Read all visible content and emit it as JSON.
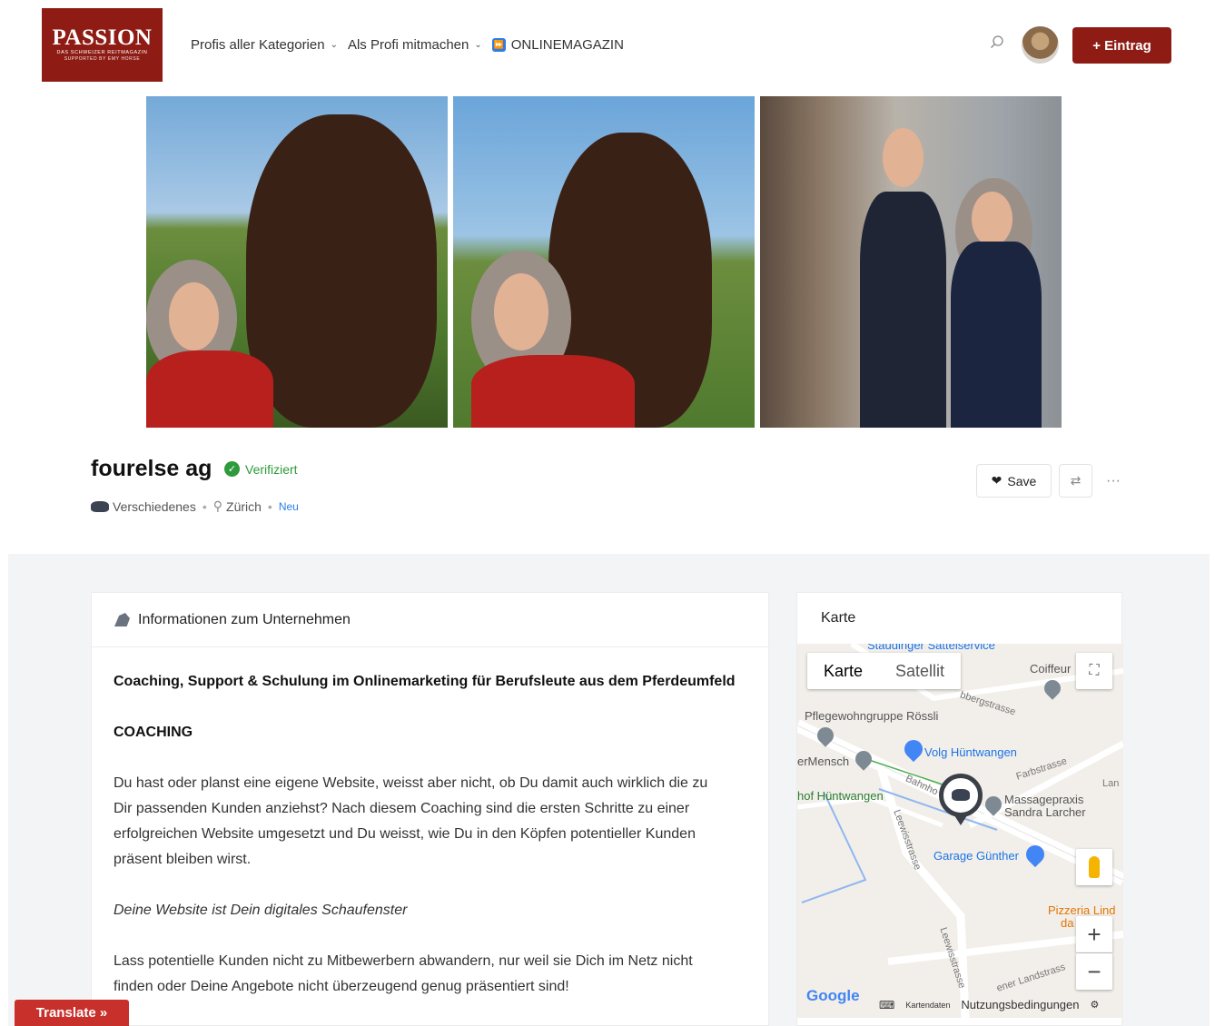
{
  "header": {
    "logo": {
      "line1": "PASSION",
      "line2": "DAS SCHWEIZER REITMAGAZIN",
      "line3": "SUPPORTED BY EMY HORSE"
    },
    "nav": [
      {
        "label": "Profis aller Kategorien",
        "has_dropdown": true
      },
      {
        "label": "Als Profi mitmachen",
        "has_dropdown": true
      },
      {
        "label": "ONLINEMAGAZIN",
        "has_dropdown": false,
        "icon": "fast-forward-icon"
      }
    ],
    "eintrag_label": "+ Eintrag",
    "accent": "#8e1c15"
  },
  "listing": {
    "name": "fourelse ag",
    "verified_label": "Verifiziert",
    "category": "Verschiedenes",
    "location": "Zürich",
    "badge": "Neu",
    "save_label": "Save",
    "more_label": "···",
    "photos": 3
  },
  "info": {
    "heading": "Informationen zum Unternehmen",
    "lead": "Coaching, Support & Schulung im Onlinemarketing für Berufsleute aus dem Pferdeumfeld",
    "caps": "COACHING",
    "para1_line1": "Du hast oder planst eine eigene Website, weisst aber nicht, ob Du damit auch wirklich die zu",
    "para1_line2": "Dir passenden Kunden anziehst? Nach diesem Coaching sind die ersten Schritte zu einer",
    "para1_line3": "erfolgreichen Website umgesetzt und Du weisst, wie Du in den Köpfen potentieller Kunden",
    "para1_line4": "präsent bleiben wirst.",
    "italic": "Deine Website ist Dein digitales Schaufenster",
    "para2_line1": "Lass potentielle Kunden nicht zu Mitbewerbern abwandern, nur weil sie Dich im Netz nicht",
    "para2_line2": "finden oder Deine Angebote nicht überzeugend genug präsentiert sind!"
  },
  "map": {
    "heading": "Karte",
    "toggle_map": "Karte",
    "toggle_sat": "Satellit",
    "labels": {
      "stauding": "Staudinger Sattelservice",
      "coiffeur": "Coiffeur",
      "pflege": "Pflegewohngruppe Rössli",
      "volg": "Volg Hüntwangen",
      "ermensch": "erMensch",
      "farb": "Farbstrasse",
      "hof": "hof Hüntwangen",
      "bahnhof": "Bahnho",
      "massage1": "Massagepraxis",
      "massage2": "Sandra Larcher",
      "leewis1": "Leewisstrasse",
      "garage": "Garage Günther",
      "pizzeria1": "Pizzeria Lind",
      "pizzeria2": "da",
      "leewis2": "Leewisstrasse",
      "landstr": "ener Landstrass",
      "bberg": "bbergstrasse",
      "lan": "Lan"
    },
    "google": "Google",
    "kartendaten": "Kartendaten",
    "terms": "Nutzungsbedingungen",
    "zoom_in": "+",
    "zoom_out": "−"
  },
  "translate_label": "Translate »"
}
